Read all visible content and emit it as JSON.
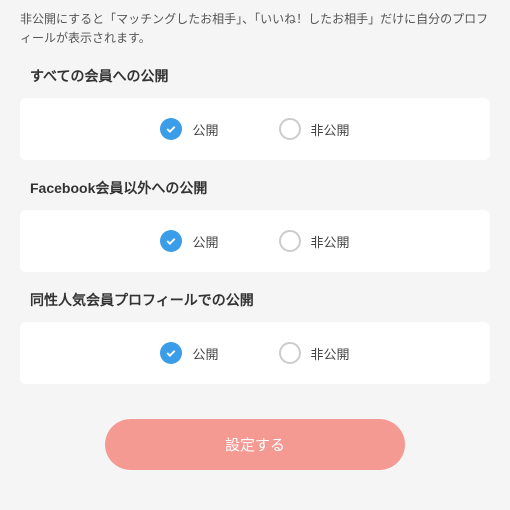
{
  "description": "非公開にすると「マッチングしたお相手」、「いいね！したお相手」だけに自分のプロフィールが表示されます。",
  "options": {
    "public_label": "公開",
    "private_label": "非公開"
  },
  "sections": [
    {
      "title": "すべての会員への公開"
    },
    {
      "title": "Facebook会員以外への公開"
    },
    {
      "title": "同性人気会員プロフィールでの公開"
    }
  ],
  "submit_label": "設定する"
}
